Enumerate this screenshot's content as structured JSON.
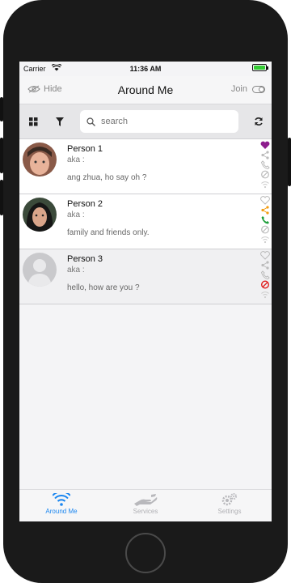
{
  "status_bar": {
    "carrier": "Carrier",
    "time": "11:36 AM",
    "battery_color": "#33cc33"
  },
  "navbar": {
    "hide_label": "Hide",
    "title": "Around Me",
    "join_label": "Join"
  },
  "toolbar": {
    "search_placeholder": "search"
  },
  "people": [
    {
      "name": "Person 1",
      "aka": "aka :",
      "status": "ang zhua, ho say oh ?",
      "avatar": "photo-boy",
      "liked": true,
      "shared": false,
      "callable": false,
      "blocked": false
    },
    {
      "name": "Person 2",
      "aka": "aka :",
      "status": "family and friends only.",
      "avatar": "photo-girl",
      "liked": false,
      "shared": true,
      "callable": true,
      "blocked": false
    },
    {
      "name": "Person 3",
      "aka": "aka :",
      "status": "hello, how are you ?",
      "avatar": "placeholder",
      "liked": false,
      "shared": false,
      "callable": false,
      "blocked": true
    }
  ],
  "tabbar": {
    "tabs": [
      {
        "label": "Around Me",
        "icon": "wifi-icon",
        "active": true
      },
      {
        "label": "Services",
        "icon": "hand-icon",
        "active": false
      },
      {
        "label": "Settings",
        "icon": "gears-icon",
        "active": false
      }
    ]
  },
  "colors": {
    "accent": "#1a86f0",
    "like": "#8e1e8e",
    "share": "#f39c12",
    "call": "#1e9e3a",
    "block": "#e02020"
  }
}
